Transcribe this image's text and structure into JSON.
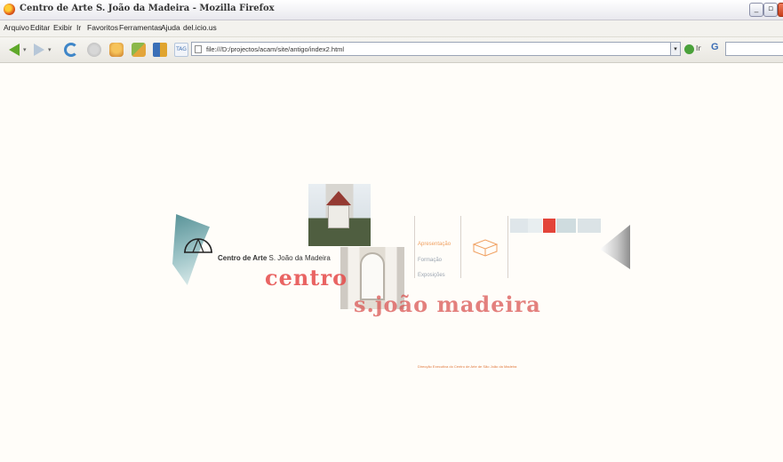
{
  "window": {
    "title": "Centro de Arte S. João da Madeira - Mozilla Firefox",
    "controls": [
      "minimize",
      "maximize",
      "close"
    ]
  },
  "menu": {
    "items": [
      "Arquivo",
      "Editar",
      "Exibir",
      "Ir",
      "Favoritos",
      "Ferramentas",
      "Ajuda",
      "del.icio.us"
    ]
  },
  "toolbar": {
    "url": "file:///D:/projectos/acam/site/antigo/index2.html",
    "tag_label": "TAG",
    "go_label": "Ir",
    "search_engine_label": "G"
  },
  "site": {
    "logo_text_bold": "Centro de Arte",
    "logo_text_regular": "S. João da Madeira",
    "nav": [
      {
        "label": "Apresentação",
        "color": "#f0a060"
      },
      {
        "label": "Formação",
        "color": "#9aa4b0"
      },
      {
        "label": "Exposições",
        "color": "#9aa4b0"
      }
    ],
    "big_text_line1": "centro",
    "big_text_line2": "s.joão madeira",
    "footer": "Direcção Executiva do Centro de Arte de São João da Madeira",
    "color_bar": [
      "#dfe6ea",
      "#e8eef0",
      "#e3453a",
      "#cfdcdf",
      "#dbe3e6"
    ]
  }
}
